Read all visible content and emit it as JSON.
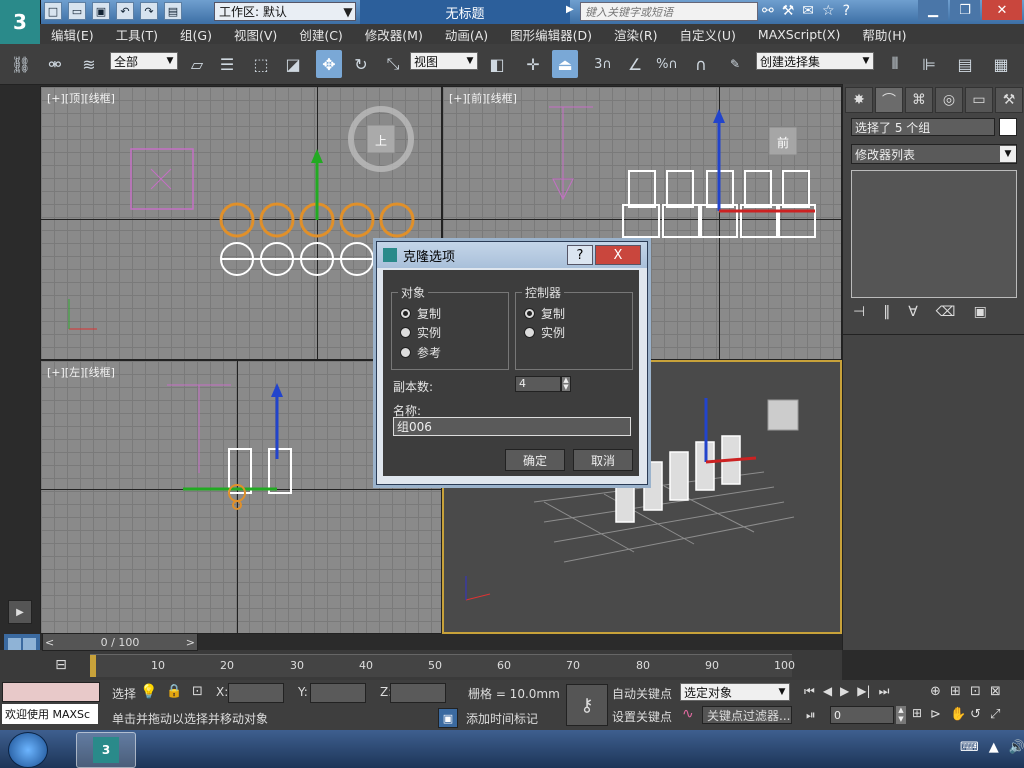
{
  "app": {
    "logo_text": "3",
    "workspace_label": "工作区: 默认",
    "document_title": "无标题",
    "search_placeholder": "键入关键字或短语"
  },
  "menu": {
    "items": [
      "编辑(E)",
      "工具(T)",
      "组(G)",
      "视图(V)",
      "创建(C)",
      "修改器(M)",
      "动画(A)",
      "图形编辑器(D)",
      "渲染(R)",
      "自定义(U)",
      "MAXScript(X)",
      "帮助(H)"
    ]
  },
  "toolbar": {
    "selection_filter": "全部",
    "reference_coord": "视图",
    "named_selection": "创建选择集",
    "snap_3": "3",
    "snap_percent": "%"
  },
  "viewports": {
    "top_label": "[+][顶][线框]",
    "front_label": "[+][前][线框]",
    "left_label": "[+][左][线框]",
    "cube_top": "上",
    "cube_front": "前"
  },
  "dialog": {
    "title": "克隆选项",
    "help": "?",
    "close": "X",
    "object_group": "对象",
    "object_options": [
      "复制",
      "实例",
      "参考"
    ],
    "object_selected": 0,
    "controller_group": "控制器",
    "controller_options": [
      "复制",
      "实例"
    ],
    "controller_selected": 0,
    "copies_label": "副本数:",
    "copies_value": "4",
    "name_label": "名称:",
    "name_value": "组006",
    "ok": "确定",
    "cancel": "取消"
  },
  "command_panel": {
    "selection_info": "选择了 5 个组",
    "modifier_list": "修改器列表"
  },
  "timeline": {
    "frame_readout": "0 / 100",
    "ticks": [
      "10",
      "20",
      "30",
      "40",
      "50",
      "60",
      "70",
      "80",
      "90",
      "100"
    ]
  },
  "status": {
    "welcome": "欢迎使用 MAXSc",
    "select_label": "选择",
    "x_label": "X:",
    "y_label": "Y:",
    "z_label": "Z:",
    "grid": "栅格 = 10.0mm",
    "prompt": "单击并拖动以选择并移动对象",
    "add_time_tag": "添加时间标记",
    "auto_key": "自动关键点",
    "set_key": "设置关键点",
    "key_mode": "选定对象",
    "key_filters": "关键点过滤器...",
    "frame_value": "0"
  }
}
